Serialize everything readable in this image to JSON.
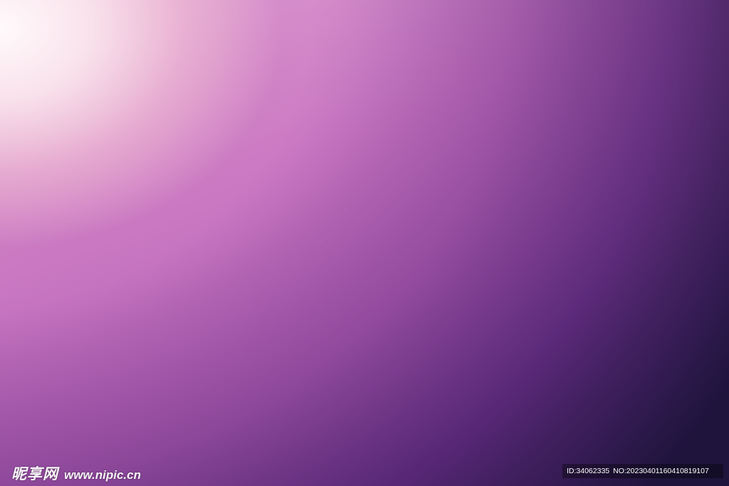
{
  "watermark": {
    "logo_text": "昵享网",
    "url": "www.nipic.cn"
  },
  "info_strip": {
    "id_text": "ID:34062335",
    "no_text": "NO:20230401160410819107"
  },
  "colors": {
    "highlight": "#fff8fb",
    "pink": "#e9b2d3",
    "magenta": "#c77cc0",
    "purple": "#7a3f8e",
    "deep": "#150f2a"
  }
}
